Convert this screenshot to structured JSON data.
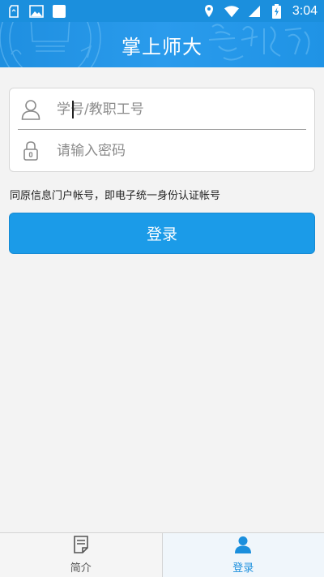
{
  "status_bar": {
    "time": "3:04",
    "left_icons": [
      "sim-card-icon",
      "image-icon",
      "app-square-icon"
    ],
    "right_icons": [
      "location-icon",
      "wifi-icon",
      "signal-icon",
      "battery-charging-icon"
    ]
  },
  "header": {
    "title": "掌上师大",
    "background_color": "#1f8fe0"
  },
  "login_form": {
    "username_placeholder": "学号/教职工号",
    "username_value": "",
    "password_placeholder": "请输入密码",
    "password_value": "",
    "hint": "同原信息门户帐号，即电子统一身份认证帐号",
    "submit_label": "登录",
    "button_color": "#1b9be8"
  },
  "bottom_nav": {
    "items": [
      {
        "label": "简介",
        "icon": "document-icon",
        "active": false
      },
      {
        "label": "登录",
        "icon": "person-icon",
        "active": true
      }
    ],
    "active_color": "#1b8fdd"
  }
}
